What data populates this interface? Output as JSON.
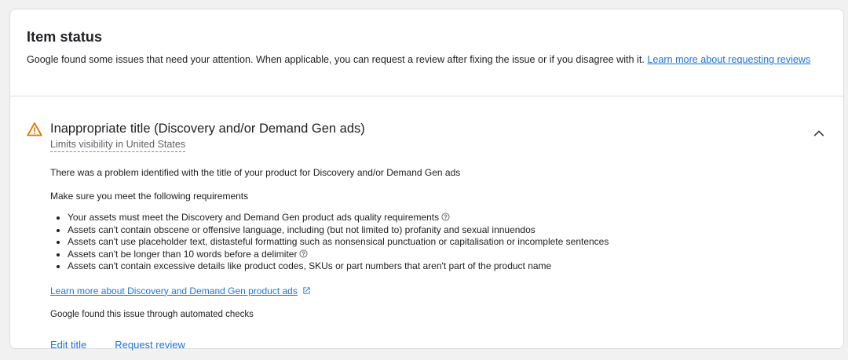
{
  "header": {
    "title": "Item status",
    "description": "Google found some issues that need your attention. When applicable, you can request a review after fixing the issue or if you disagree with it.",
    "link_text": "Learn more about requesting reviews"
  },
  "issue": {
    "title": "Inappropriate title (Discovery and/or Demand Gen ads)",
    "subtitle": "Limits visibility in United States",
    "problem_text": "There was a problem identified with the title of your product for Discovery and/or Demand Gen ads",
    "requirements_intro": "Make sure you meet the following requirements",
    "requirements": [
      "Your assets must meet the Discovery and Demand Gen product ads quality requirements",
      "Assets can't contain obscene or offensive language, including (but not limited to) profanity and sexual innuendos",
      "Assets can't use placeholder text, distasteful formatting such as nonsensical punctuation or capitalisation or incomplete sentences",
      "Assets can't be longer than 10 words before a delimiter",
      "Assets can't contain excessive details like product codes, SKUs or part numbers that aren't part of the product name"
    ],
    "learn_more_link": "Learn more about Discovery and Demand Gen product ads",
    "automated_note": "Google found this issue through automated checks",
    "actions": {
      "edit": "Edit title",
      "review": "Request review"
    }
  },
  "colors": {
    "link": "#1a73e8",
    "warning": "#e37400",
    "text": "#202124",
    "subtext": "#5f6368"
  },
  "icons": {
    "warning": "warning-triangle-icon",
    "chevron": "chevron-up-icon",
    "help": "help-circle-icon",
    "external": "open-in-new-icon"
  }
}
